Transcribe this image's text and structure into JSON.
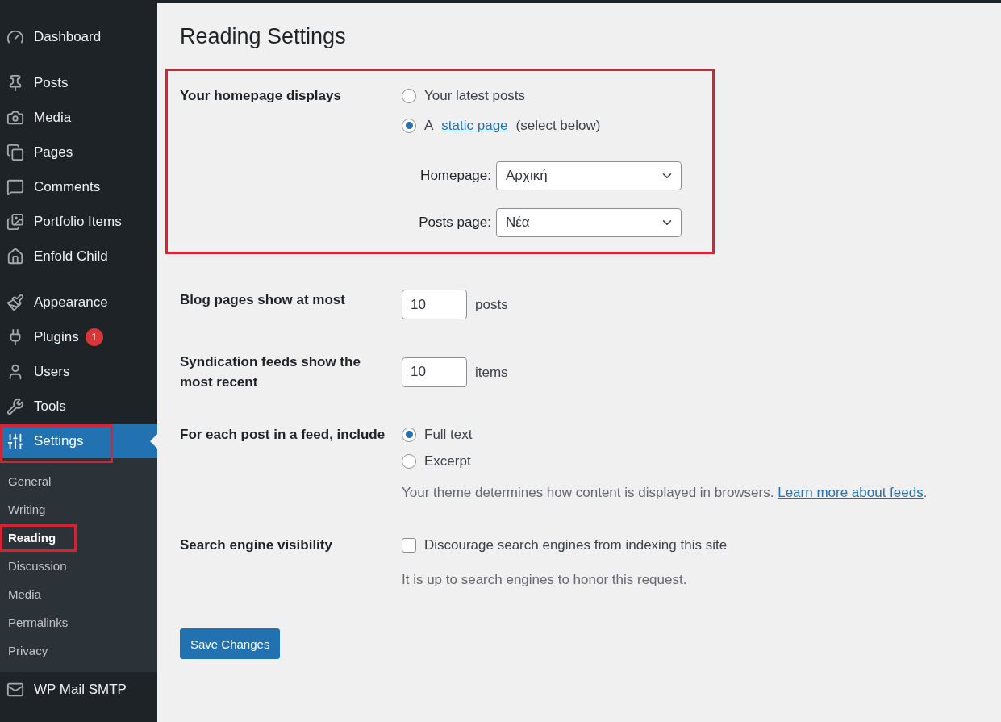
{
  "sidebar": {
    "groups": [
      [
        {
          "label": "Dashboard",
          "selected": false,
          "highlighted": false
        }
      ],
      [
        {
          "label": "Posts",
          "selected": false,
          "highlighted": false
        },
        {
          "label": "Media",
          "selected": false,
          "highlighted": false
        },
        {
          "label": "Pages",
          "selected": false,
          "highlighted": false
        },
        {
          "label": "Comments",
          "selected": false,
          "highlighted": false
        },
        {
          "label": "Portfolio Items",
          "selected": false,
          "highlighted": false
        },
        {
          "label": "Enfold Child",
          "selected": false,
          "highlighted": false
        }
      ],
      [
        {
          "label": "Appearance",
          "selected": false,
          "highlighted": false
        },
        {
          "label": "Plugins",
          "badge": "1",
          "selected": false,
          "highlighted": false
        },
        {
          "label": "Users",
          "selected": false,
          "highlighted": false
        },
        {
          "label": "Tools",
          "selected": false,
          "highlighted": false
        },
        {
          "label": "Settings",
          "selected": true,
          "highlighted": true,
          "children": [
            {
              "label": "General",
              "selected": false,
              "highlighted": false
            },
            {
              "label": "Writing",
              "selected": false,
              "highlighted": false
            },
            {
              "label": "Reading",
              "selected": true,
              "highlighted": true
            },
            {
              "label": "Discussion",
              "selected": false,
              "highlighted": false
            },
            {
              "label": "Media",
              "selected": false,
              "highlighted": false
            },
            {
              "label": "Permalinks",
              "selected": false,
              "highlighted": false
            },
            {
              "label": "Privacy",
              "selected": false,
              "highlighted": false
            }
          ]
        },
        {
          "label": "WP Mail SMTP",
          "selected": false,
          "highlighted": false
        }
      ]
    ]
  },
  "main": {
    "title": "Reading Settings",
    "rows": [
      {
        "kind": "homepage",
        "label": "Your homepage displays",
        "highlighted": true,
        "options": [
          {
            "text": "Your latest posts",
            "selected": false
          },
          {
            "text": "A",
            "link": "static page",
            "suffix": "(select below)",
            "selected": true
          }
        ],
        "selects": [
          {
            "label": "Homepage:",
            "value": "Αρχική"
          },
          {
            "label": "Posts page:",
            "value": "Νέα"
          }
        ]
      },
      {
        "kind": "number",
        "label": "Blog pages show at most",
        "value": "10",
        "unit": "posts"
      },
      {
        "kind": "number",
        "label": "Syndication feeds show the most recent",
        "value": "10",
        "unit": "items"
      },
      {
        "kind": "radio",
        "label": "For each post in a feed, include",
        "options": [
          {
            "text": "Full text",
            "selected": true
          },
          {
            "text": "Excerpt",
            "selected": false
          }
        ],
        "description": {
          "text": "Your theme determines how content is displayed in browsers.",
          "link": "Learn more about feeds",
          "suffix": "."
        }
      },
      {
        "kind": "checkbox",
        "label": "Search engine visibility",
        "text": "Discourage search engines from indexing this site",
        "checked": false,
        "description": {
          "text": "It is up to search engines to honor this request."
        }
      }
    ],
    "button": "Save Changes"
  }
}
